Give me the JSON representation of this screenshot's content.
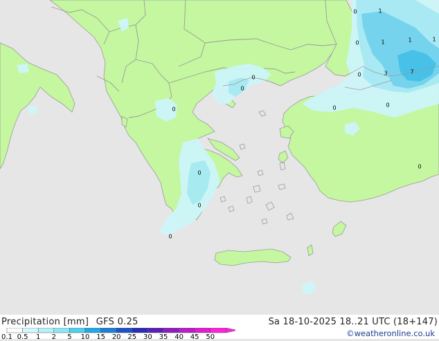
{
  "title": "Precipitation [mm]",
  "model": "GFS 0.25",
  "valid_time": "Sa 18-10-2025 18..21 UTC (18+147)",
  "credit": "©weatheronline.co.uk",
  "colors": {
    "sea": "#e6e6e6",
    "land": "#c4f7a0",
    "coast": "#9a9a9a",
    "border": "#9a9a9a",
    "precip_light": "#cdf5fa",
    "precip_mid": "#a6eaf5",
    "precip_heavy": "#6fd3ee",
    "precip_max": "#3fc0e8"
  },
  "legend": {
    "ticks": [
      "0.1",
      "0.5",
      "1",
      "2",
      "5",
      "10",
      "15",
      "20",
      "25",
      "30",
      "35",
      "40",
      "45",
      "50"
    ],
    "colors": [
      "#ffffff",
      "#d2f8fc",
      "#b4f1f8",
      "#8ee6f3",
      "#4fd0ec",
      "#22a9e3",
      "#1d7fd6",
      "#1d52c8",
      "#2a2cb8",
      "#5b1fb8",
      "#8c1ec0",
      "#b91dc7",
      "#e21cd0",
      "#ff22dc"
    ]
  },
  "grid_values": [
    {
      "text": "0"
    },
    {
      "text": "1"
    },
    {
      "text": "0"
    },
    {
      "text": "1"
    },
    {
      "text": "1"
    },
    {
      "text": "1"
    },
    {
      "text": "0"
    },
    {
      "text": "3"
    },
    {
      "text": "7"
    },
    {
      "text": "0"
    },
    {
      "text": "0"
    },
    {
      "text": "0"
    },
    {
      "text": "0"
    },
    {
      "text": "0"
    },
    {
      "text": "0"
    },
    {
      "text": "0"
    },
    {
      "text": "0"
    },
    {
      "text": "0"
    }
  ]
}
